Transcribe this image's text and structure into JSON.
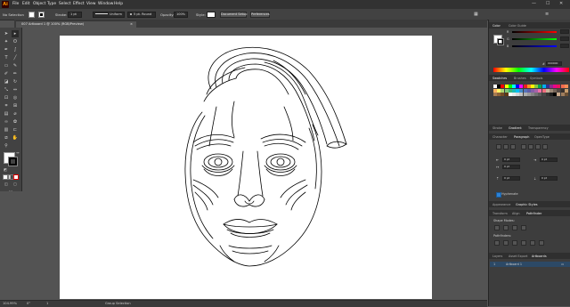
{
  "app": {
    "logo": "Ai"
  },
  "menubar": {
    "items": [
      "File",
      "Edit",
      "Object",
      "Type",
      "Select",
      "Effect",
      "View",
      "Window",
      "Help"
    ],
    "window_controls": [
      "—",
      "☐",
      "✕"
    ]
  },
  "controlbar": {
    "selection_label": "No Selection",
    "stroke_label": "Stroke:",
    "stroke_value": "1 pt",
    "profile_value": "Uniform",
    "brush_value": "5 pt. Round",
    "opacity_label": "Opacity:",
    "opacity_value": "100%",
    "style_label": "Style:",
    "document_setup": "Document Setup",
    "preferences": "Preferences"
  },
  "document": {
    "tab_title": "007 Artboard 1 @ 100% (RGB/Preview)",
    "close_glyph": "×"
  },
  "status": {
    "zoom": "104.99%",
    "rotation": "0°",
    "artboard_number": "1",
    "mode": "Group Selection"
  },
  "panels": {
    "color": {
      "tabs": [
        "Color",
        "Color Guide"
      ],
      "channels": [
        "R",
        "G",
        "B"
      ],
      "hex": "000000"
    },
    "swatches": {
      "tabs": [
        "Swatches",
        "Brushes",
        "Symbols"
      ]
    },
    "stroke_group": {
      "tabs": [
        "Stroke",
        "Gradient",
        "Transparency"
      ]
    },
    "paragraph": {
      "tabs": [
        "Character",
        "Paragraph",
        "OpenType"
      ],
      "left_indent": "0 pt",
      "right_indent": "0 pt",
      "first_indent": "0 pt",
      "space_before": "0 pt",
      "space_after": "0 pt",
      "hyphenate": "Hyphenate"
    },
    "appearance": {
      "tabs": [
        "Appearance",
        "Graphic Styles"
      ]
    },
    "pathfinder": {
      "tabs": [
        "Transform",
        "Align",
        "Pathfinder"
      ],
      "shape_modes": "Shape Modes:",
      "pathfinders": "Pathfinders:"
    },
    "layers": {
      "tabs": [
        "Layers",
        "Asset Export",
        "Artboards"
      ],
      "artboard_index": "1",
      "artboard_name": "Artboard 1"
    }
  },
  "colors": {
    "accent": "#2c4966",
    "app_bg": "#535353",
    "panel_bg": "#3d3d3d",
    "swatch_grid": [
      "#ffffff",
      "#000000",
      "#ff0000",
      "#ffff00",
      "#00ff00",
      "#00ffff",
      "#0000ff",
      "#ff00ff",
      "#ed1c24",
      "#f7941d",
      "#fff200",
      "#8dc63f",
      "#00a651",
      "#00aeef",
      "#2e3192",
      "#92278f",
      "#ec008c",
      "#ed145b",
      "#f26c4f",
      "#f68e56",
      "#fbaf5d",
      "#fff568",
      "#acd372",
      "#7cc576",
      "#3bb878",
      "#1abbb4",
      "#00bff3",
      "#438ccb",
      "#5674b9",
      "#605ca8",
      "#855fa8",
      "#a763a8",
      "#f06ea9",
      "#f26d7d",
      "#c7b299",
      "#998675",
      "#736357",
      "#534741",
      "#37302d",
      "#c69c6d",
      "#a67c52",
      "#8c6239",
      "#754c24",
      "#603913",
      "#ffffff",
      "#ebebeb",
      "#d7d7d7",
      "#c2c2c2",
      "#adadad",
      "#999999",
      "#858585",
      "#707070",
      "#5c5c5c",
      "#474747",
      "#333333",
      "#1f1f1f",
      "#000000",
      "#c8a98b",
      "#9e7d5d",
      "#6b4f33"
    ]
  }
}
